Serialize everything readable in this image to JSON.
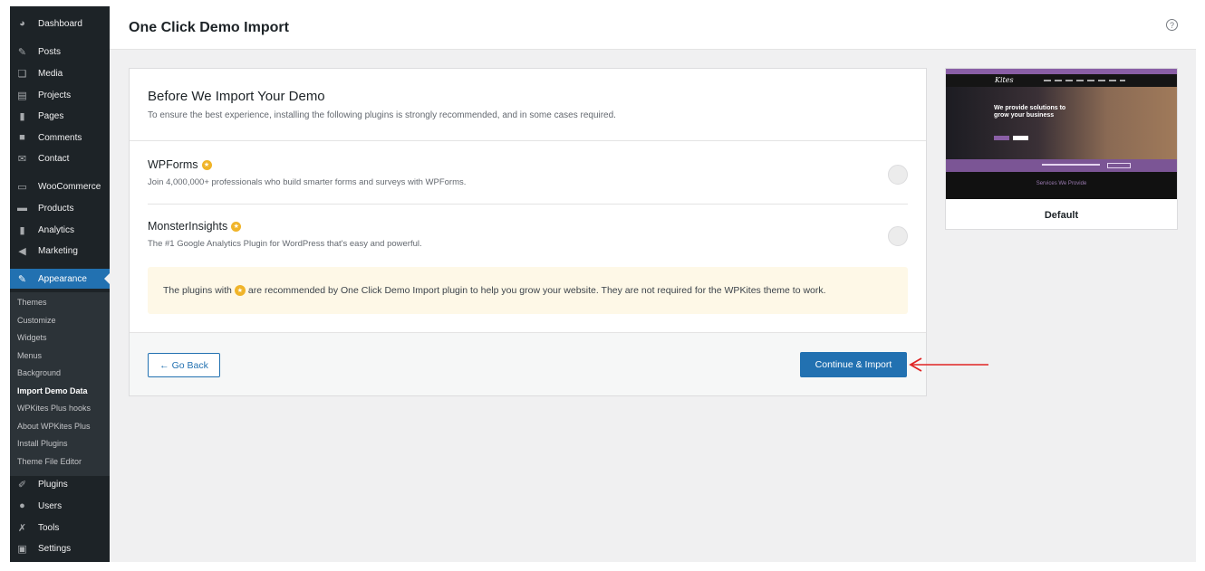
{
  "sidebar": {
    "main_top": [
      {
        "label": "Dashboard",
        "icon": "dashboard-icon",
        "glyph": "◕"
      },
      {
        "label": "Posts",
        "icon": "pin-icon",
        "glyph": "✎"
      },
      {
        "label": "Media",
        "icon": "media-icon",
        "glyph": "❏"
      },
      {
        "label": "Projects",
        "icon": "projects-icon",
        "glyph": "▤"
      },
      {
        "label": "Pages",
        "icon": "pages-icon",
        "glyph": "▮"
      },
      {
        "label": "Comments",
        "icon": "comments-icon",
        "glyph": "■"
      },
      {
        "label": "Contact",
        "icon": "mail-icon",
        "glyph": "✉"
      },
      {
        "label": "WooCommerce",
        "icon": "woo-icon",
        "glyph": "▭"
      },
      {
        "label": "Products",
        "icon": "products-icon",
        "glyph": "▬"
      },
      {
        "label": "Analytics",
        "icon": "analytics-icon",
        "glyph": "▮"
      },
      {
        "label": "Marketing",
        "icon": "megaphone-icon",
        "glyph": "◀"
      }
    ],
    "active": {
      "label": "Appearance",
      "icon": "brush-icon",
      "glyph": "✎"
    },
    "submenu": [
      "Themes",
      "Customize",
      "Widgets",
      "Menus",
      "Background",
      "Import Demo Data",
      "WPKites Plus hooks",
      "About WPKites Plus",
      "Install Plugins",
      "Theme File Editor"
    ],
    "current_sub": "Import Demo Data",
    "main_bottom": [
      {
        "label": "Plugins",
        "icon": "plugins-icon",
        "glyph": "✐"
      },
      {
        "label": "Users",
        "icon": "users-icon",
        "glyph": "●"
      },
      {
        "label": "Tools",
        "icon": "tools-icon",
        "glyph": "✗"
      },
      {
        "label": "Settings",
        "icon": "settings-icon",
        "glyph": "▣"
      }
    ]
  },
  "header": {
    "title": "One Click Demo Import",
    "help_glyph": "?"
  },
  "card": {
    "title": "Before We Import Your Demo",
    "subtitle": "To ensure the best experience, installing the following plugins is strongly recommended, and in some cases required.",
    "plugins": [
      {
        "name": "WPForms",
        "desc": "Join 4,000,000+ professionals who build smarter forms and surveys with WPForms."
      },
      {
        "name": "MonsterInsights",
        "desc": "The #1 Google Analytics Plugin for WordPress that's easy and powerful."
      }
    ],
    "notice_before": "The plugins with",
    "notice_after": "are recommended by One Click Demo Import plugin to help you grow your website. They are not required for the WPKites theme to work.",
    "back_label": "← Go Back",
    "continue_label": "Continue & Import"
  },
  "preview": {
    "label": "Default",
    "logo": "Kites",
    "hero": "We provide solutions to grow your business",
    "services": "Services We Provide"
  },
  "colors": {
    "accent": "#2271b1",
    "annotation": "#e02424",
    "star": "#f0b429"
  }
}
